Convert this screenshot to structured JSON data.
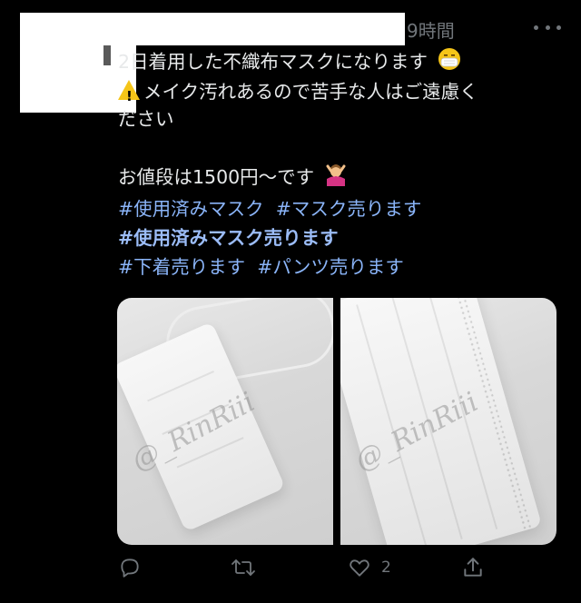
{
  "tweet": {
    "timestamp": "9時間",
    "lines": [
      "2日着用した不織布マスクになります",
      "メイク汚れあるので苦手な人はご遠慮く",
      "ださい",
      "お値段は1500円〜です"
    ],
    "hashtags_row1": [
      "#使用済みマスク",
      "#マスク売ります"
    ],
    "hashtag_bold": "#使用済みマスク売ります",
    "hashtags_row3": [
      "#下着売ります",
      "#パンツ売ります"
    ]
  },
  "media": {
    "watermark_left": "@_RinRiii",
    "watermark_right": "@_RinRiii"
  },
  "actions": {
    "like_count": "2"
  },
  "icons": {
    "reply": "reply-icon",
    "retweet": "retweet-icon",
    "like": "heart-icon",
    "share": "share-icon",
    "more": "more-icon",
    "warning": "warning-emoji",
    "mask_face": "mask-face-emoji",
    "no_gesture": "no-gesture-emoji"
  },
  "colors": {
    "background": "#000000",
    "text": "#e7e9ea",
    "muted": "#71767b",
    "link": "#8ab4f8"
  }
}
